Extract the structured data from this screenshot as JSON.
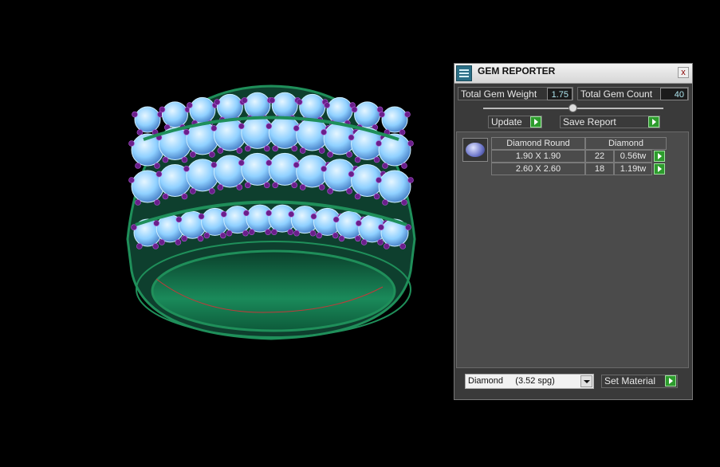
{
  "panel": {
    "title": "GEM REPORTER",
    "close_label": "x",
    "total_gem_weight_label": "Total Gem Weight",
    "total_gem_weight_value": "1.75",
    "total_gem_count_label": "Total Gem Count",
    "total_gem_count_value": "40",
    "update_label": "Update",
    "save_report_label": "Save Report",
    "table": {
      "header_shape": "Diamond Round",
      "header_material": "Diamond",
      "rows": [
        {
          "size": "1.90 X 1.90",
          "count": "22",
          "weight": "0.56tw"
        },
        {
          "size": "2.60 X 2.60",
          "count": "18",
          "weight": "1.19tw"
        }
      ]
    },
    "material_select_value": "Diamond     (3.52 spg)",
    "set_material_label": "Set Material"
  },
  "colors": {
    "ring_band": "#1f8f5a",
    "gems": "#8fd0ff",
    "prongs": "#6a1f8a",
    "go_button": "#2d9c2d"
  },
  "icons": [
    "gem-reporter-icon",
    "close-icon",
    "go-arrow-icon",
    "gem-thumbnail-icon",
    "dropdown-arrow-icon"
  ]
}
